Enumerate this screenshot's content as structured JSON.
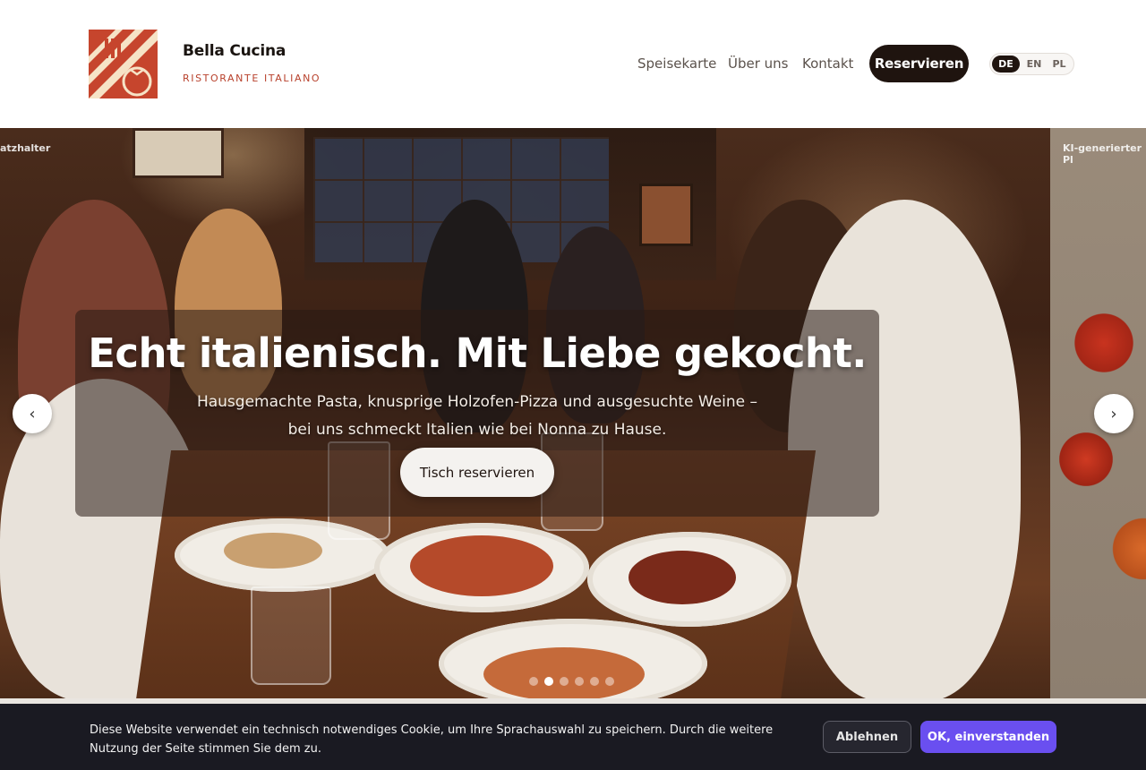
{
  "header": {
    "brand_name": "Bella Cucina",
    "brand_subtitle": "RISTORANTE ITALIANO",
    "nav": [
      "Speisekarte",
      "Über uns",
      "Kontakt"
    ],
    "reserve_label": "Reservieren",
    "languages": [
      "DE",
      "EN",
      "PL"
    ],
    "active_language": "DE"
  },
  "hero": {
    "placeholder_left": "atzhalter",
    "placeholder_right": "KI-generierter Pl",
    "title": "Echt italienisch. Mit Liebe gekocht.",
    "subtitle_line1": "Hausgemachte Pasta, knusprige Holzofen-Pizza und ausgesuchte Weine –",
    "subtitle_line2": "bei uns schmeckt Italien wie bei Nonna zu Hause.",
    "cta_label": "Tisch reservieren",
    "prev_arrow": "‹",
    "next_arrow": "›",
    "slide_count": 6,
    "active_slide": 2
  },
  "cookie_banner": {
    "text": "Diese Website verwendet ein technisch notwendiges Cookie, um Ihre Sprachauswahl zu speichern. Durch die weitere Nutzung der Seite stimmen Sie dem zu.",
    "decline_label": "Ablehnen",
    "accept_label": "OK, einverstanden"
  },
  "colors": {
    "brand_dark": "#1f140f",
    "brand_accent": "#b8412c",
    "accept_button": "#6a4ff0",
    "cookie_background": "#1a1a22"
  },
  "icons": {
    "logo": "restaurant-logo-fork-tomato-icon",
    "prev": "chevron-left-icon",
    "next": "chevron-right-icon"
  }
}
